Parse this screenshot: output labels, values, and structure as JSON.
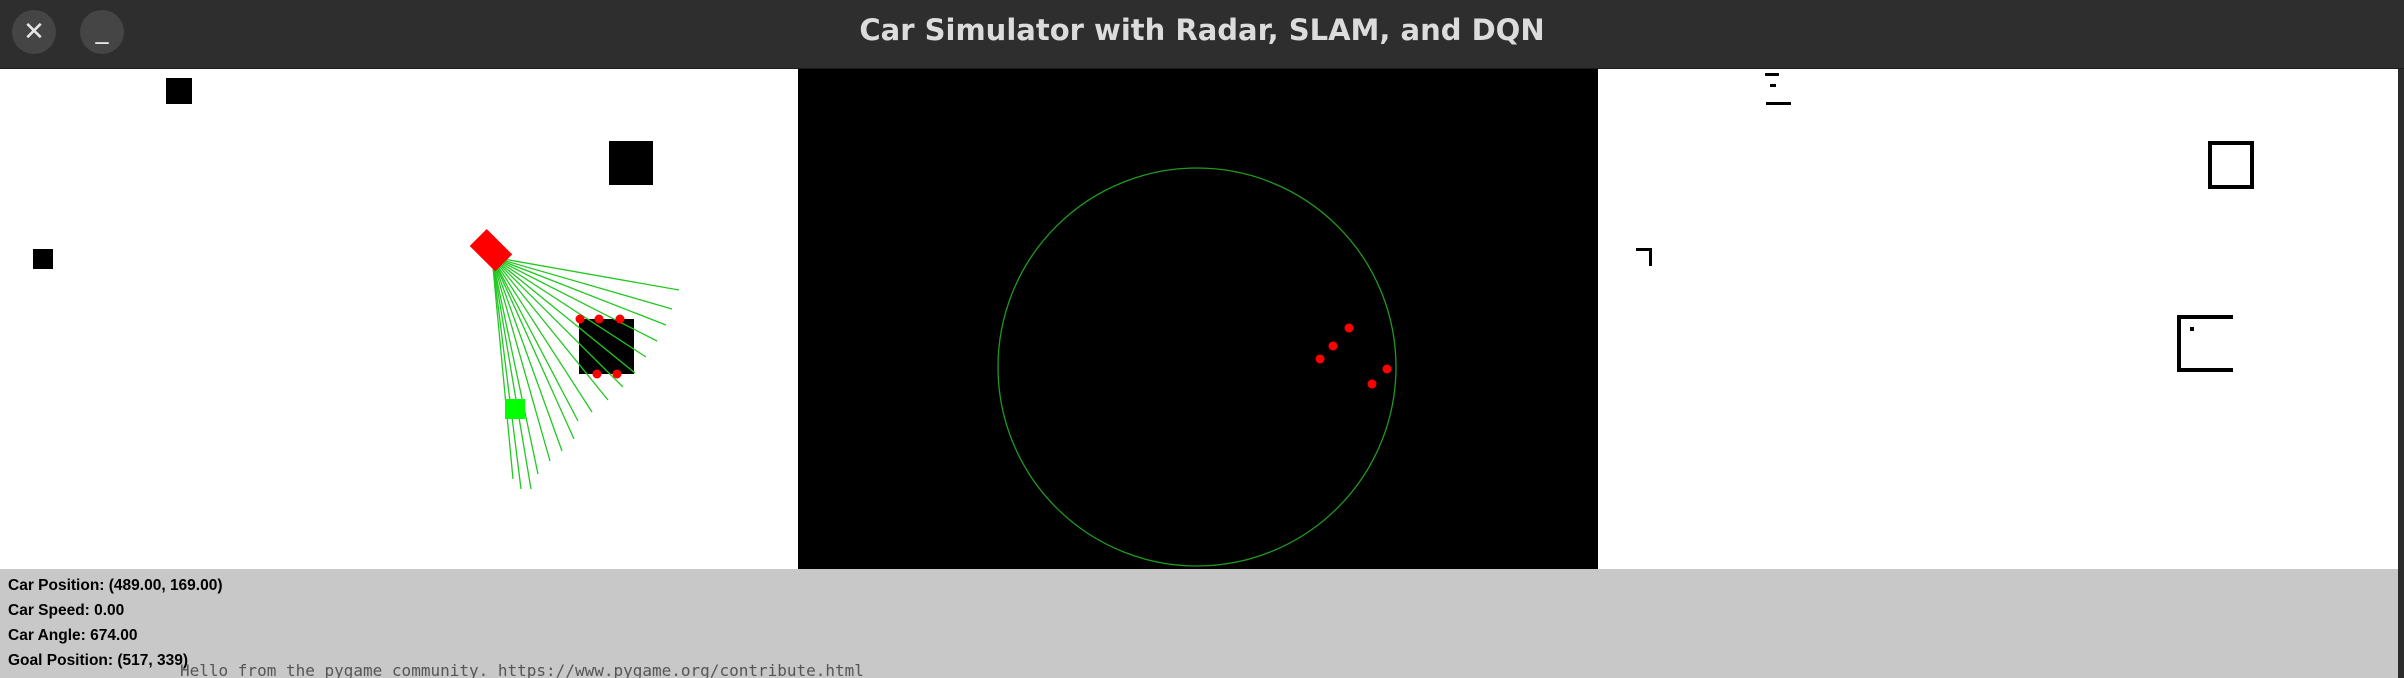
{
  "window": {
    "title": "Car Simulator with Radar, SLAM, and DQN",
    "close_glyph": "✕",
    "minimize_glyph": "_"
  },
  "info": {
    "car_position": "Car Position: (489.00, 169.00)",
    "car_speed": "Car Speed: 0.00",
    "car_angle": "Car Angle: 674.00",
    "goal_position": "Goal Position: (517, 339)"
  },
  "console_text": "Hello from the pygame community. https://www.pygame.org/contribute.html",
  "colors": {
    "car": "#ff0000",
    "radar": "#00c800",
    "goal": "#00ff00",
    "obstacle": "#000000",
    "hit": "#ff0000"
  }
}
